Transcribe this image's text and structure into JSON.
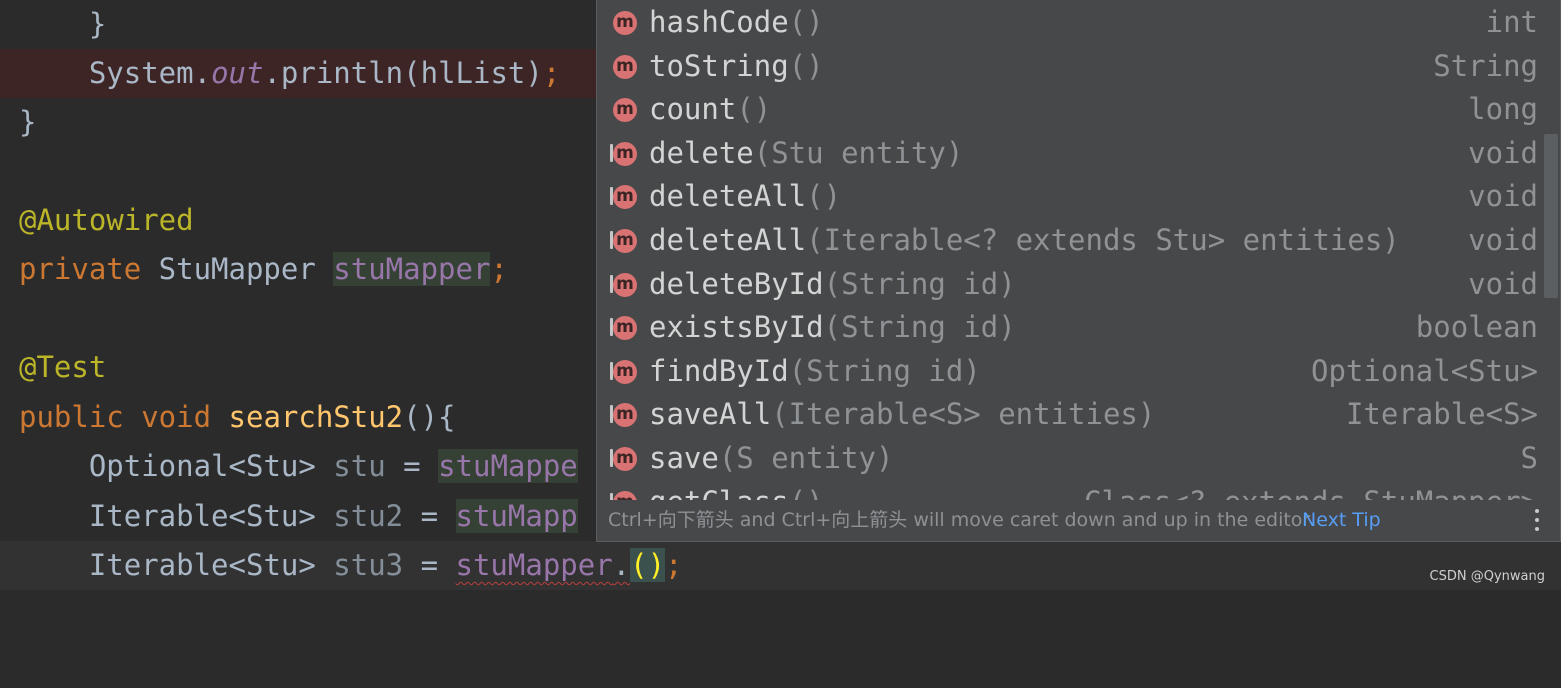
{
  "editor": {
    "lines": [
      {
        "text": "    }"
      },
      {
        "indent": "    ",
        "cls": "System",
        "dot1": ".",
        "out": "out",
        "dot2": ".println(hlList)",
        "semi": ";"
      },
      {
        "text": "}"
      },
      {
        "text": ""
      },
      {
        "annotation": "@Autowired"
      },
      {
        "kw": "private",
        "type": " StuMapper ",
        "field": "stuMapper",
        "semi": ";"
      },
      {
        "text": ""
      },
      {
        "annotation": "@Test"
      },
      {
        "kw1": "public",
        "kw2": " void ",
        "fn": "searchStu2",
        "rest": "(){"
      },
      {
        "indent": "    ",
        "type": "Optional<Stu> ",
        "local": "stu",
        "eq": " = ",
        "field": "stuMappe"
      },
      {
        "indent": "    ",
        "type": "Iterable<Stu> ",
        "local": "stu2",
        "eq": " = ",
        "field": "stuMapp"
      },
      {
        "indent": "    ",
        "type": "Iterable<Stu> ",
        "local": "stu3",
        "eq": " = ",
        "field": "stuMapper",
        "dot": ".",
        "parens": "()",
        "semi": ";"
      }
    ]
  },
  "completion": {
    "items": [
      {
        "name": "hashCode",
        "params": "()",
        "return_type": "int"
      },
      {
        "name": "toString",
        "params": "()",
        "return_type": "String"
      },
      {
        "name": "count",
        "params": "()",
        "return_type": "long"
      },
      {
        "name": "delete",
        "params": "(Stu entity)",
        "return_type": "void"
      },
      {
        "name": "deleteAll",
        "params": "()",
        "return_type": "void"
      },
      {
        "name": "deleteAll",
        "params": "(Iterable<? extends Stu> entities)",
        "return_type": "void"
      },
      {
        "name": "deleteById",
        "params": "(String id)",
        "return_type": "void"
      },
      {
        "name": "existsById",
        "params": "(String id)",
        "return_type": "boolean"
      },
      {
        "name": "findById",
        "params": "(String id)",
        "return_type": "Optional<Stu>"
      },
      {
        "name": "saveAll",
        "params": "(Iterable<S> entities)",
        "return_type": "Iterable<S>"
      },
      {
        "name": "save",
        "params": "(S entity)",
        "return_type": "S"
      },
      {
        "name": "getClass",
        "params": "()",
        "return_type": "Class<? extends StuMapper>"
      }
    ],
    "icon_letter": "m",
    "tip_text": "Ctrl+向下箭头 and Ctrl+向上箭头 will move caret down and up in the editor",
    "next_tip_label": "Next Tip"
  },
  "watermark": "CSDN @Qynwang",
  "colors": {
    "editor_bg": "#2b2b2b",
    "popup_bg": "#46484a",
    "keyword": "#cc7832",
    "annotation": "#bbb529",
    "field": "#9876aa",
    "method_icon": "#d97373",
    "link": "#589df6"
  }
}
